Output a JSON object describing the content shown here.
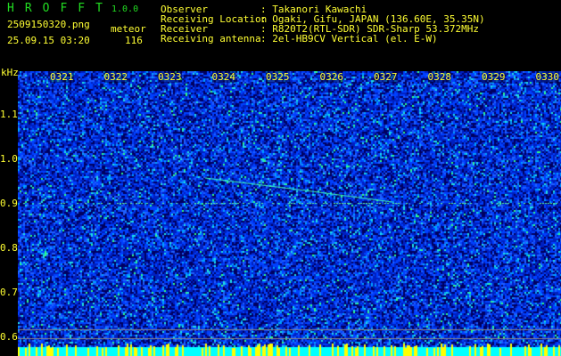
{
  "app": {
    "title": "HROFFT",
    "version": "1.0.0"
  },
  "file": {
    "name": "2509150320.png",
    "datetime": "25.09.15 03:20"
  },
  "meteor": {
    "label": "meteor",
    "count": "116"
  },
  "info": [
    {
      "label": "Observer",
      "value": ": Takanori Kawachi"
    },
    {
      "label": "Receiving Location",
      "value": ": Ogaki, Gifu, JAPAN (136.60E, 35.35N)"
    },
    {
      "label": "Receiver",
      "value": ": R820T2(RTL-SDR) SDR-Sharp 53.372MHz"
    },
    {
      "label": "Receiving antenna",
      "value": ": 2el-HB9CV Vertical (el. E-W)"
    }
  ],
  "axis": {
    "unit": "kHz",
    "y_ticks": [
      "1.1",
      "1.0",
      "0.9",
      "0.8",
      "0.7",
      "0.6"
    ],
    "x_ticks": [
      "0321",
      "0322",
      "0323",
      "0324",
      "0325",
      "0326",
      "0327",
      "0328",
      "0329",
      "0330"
    ]
  },
  "colors": {
    "text": "#ffff33",
    "title": "#22dd22",
    "bg": "#0000aa"
  }
}
